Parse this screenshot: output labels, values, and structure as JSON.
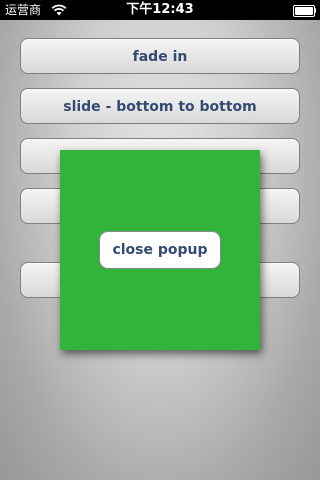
{
  "status_bar": {
    "carrier": "运营商",
    "time": "下午12:43",
    "battery_level": 1.0
  },
  "menu": {
    "buttons": [
      {
        "label": "fade in"
      },
      {
        "label": "slide - bottom to bottom"
      },
      {
        "label": ""
      },
      {
        "label": ""
      },
      {
        "label": ""
      }
    ]
  },
  "popup": {
    "background_color": "#32b43b",
    "close_label": "close popup"
  }
}
